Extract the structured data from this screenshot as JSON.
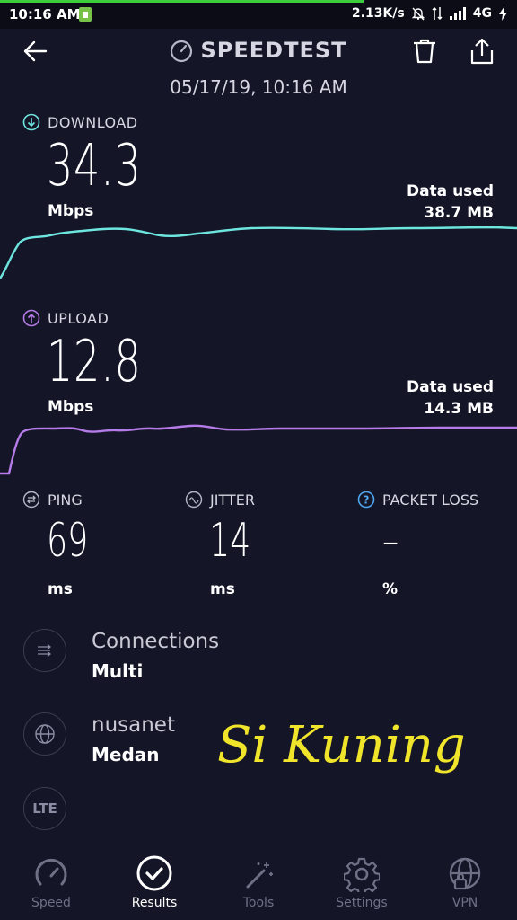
{
  "status_bar": {
    "time": "10:16 AM",
    "net_speed": "2.13K/s",
    "network": "4G"
  },
  "header": {
    "title": "SPEEDTEST",
    "subtitle": "05/17/19, 10:16 AM"
  },
  "download": {
    "label": "DOWNLOAD",
    "value": "34.3",
    "unit": "Mbps",
    "data_used_label": "Data used",
    "data_used_value": "38.7 MB",
    "color": "#6ee6e0"
  },
  "upload": {
    "label": "UPLOAD",
    "value": "12.8",
    "unit": "Mbps",
    "data_used_label": "Data used",
    "data_used_value": "14.3 MB",
    "color": "#b57be8"
  },
  "ping": {
    "label": "PING",
    "value": "69",
    "unit": "ms"
  },
  "jitter": {
    "label": "JITTER",
    "value": "14",
    "unit": "ms"
  },
  "packet_loss": {
    "label": "PACKET LOSS",
    "value": "–",
    "unit": "%"
  },
  "connections": {
    "title": "Connections",
    "value": "Multi"
  },
  "provider": {
    "name": "nusanet",
    "location": "Medan"
  },
  "network_badge": "LTE",
  "handwriting": "Si Kuning",
  "tabs": [
    {
      "label": "Speed"
    },
    {
      "label": "Results"
    },
    {
      "label": "Tools"
    },
    {
      "label": "Settings"
    },
    {
      "label": "VPN"
    }
  ]
}
